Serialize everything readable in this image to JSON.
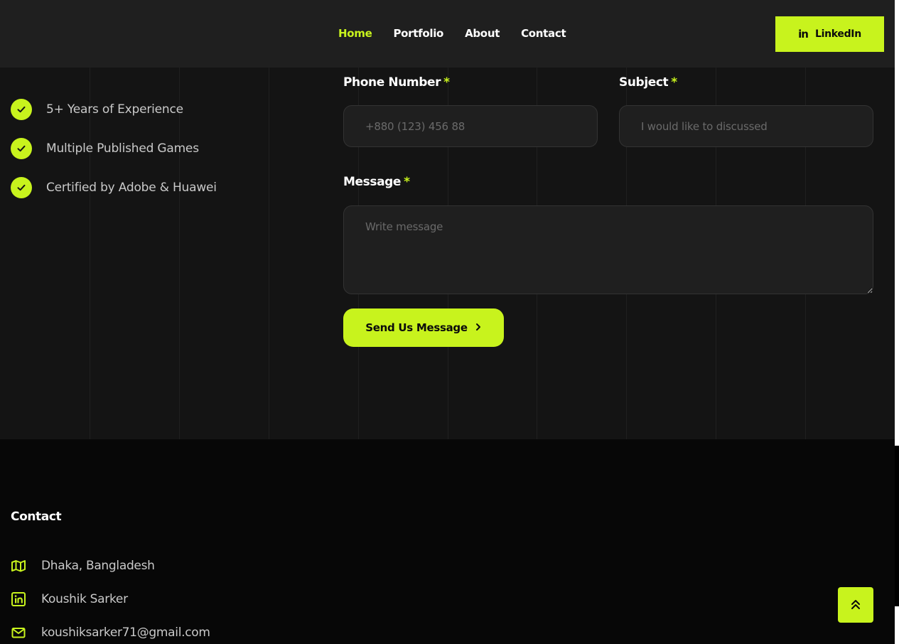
{
  "nav": {
    "items": [
      {
        "label": "Home",
        "active": true
      },
      {
        "label": "Portfolio",
        "active": false
      },
      {
        "label": "About",
        "active": false
      },
      {
        "label": "Contact",
        "active": false
      }
    ],
    "linkedin_label": "LinkedIn",
    "linkedin_glyph": "in"
  },
  "features": [
    {
      "text": "5+ Years of Experience"
    },
    {
      "text": "Multiple Published Games"
    },
    {
      "text": "Certified by Adobe & Huawei"
    }
  ],
  "form": {
    "phone": {
      "label": "Phone Number",
      "required_mark": "*",
      "placeholder": "+880 (123) 456 88",
      "value": ""
    },
    "subject": {
      "label": "Subject",
      "required_mark": "*",
      "placeholder": "I would like to discussed",
      "value": ""
    },
    "message": {
      "label": "Message",
      "required_mark": "*",
      "placeholder": "Write message",
      "value": ""
    },
    "submit_label": "Send Us Message"
  },
  "footer": {
    "title": "Contact",
    "items": [
      {
        "icon": "map-icon",
        "text": "Dhaka, Bangladesh"
      },
      {
        "icon": "linkedin-icon",
        "text": "Koushik Sarker"
      },
      {
        "icon": "mail-icon",
        "text": "koushiksarker71@gmail.com"
      }
    ]
  },
  "colors": {
    "accent": "#c8f31d",
    "header_bg": "#1f1f1f",
    "section_bg": "#141414",
    "footer_bg": "#070707"
  }
}
